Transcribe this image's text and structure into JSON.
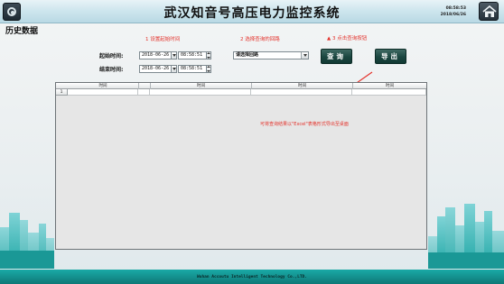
{
  "header": {
    "title": "武汉知音号高压电力监控系统",
    "time": "08:58:53",
    "date": "2018/06/26"
  },
  "page_title": "历史数据",
  "annotations": {
    "step1": "1 设置起始时间",
    "step2": "2 选择查询的回路",
    "step3": "3 点击查询按钮",
    "export_note": "可将查询结果以\"Excel\"表格形式导出至桌面"
  },
  "form": {
    "start_label": "起始时间:",
    "end_label": "结束时间:",
    "start_date": "2018-06-26",
    "start_time": "08:58:51",
    "end_date": "2018-06-26",
    "end_time": "08:58:51",
    "circuit_select_value": "请选择回路",
    "query_button": "查询",
    "export_button": "导出"
  },
  "table": {
    "columns": [
      "时间",
      "时间",
      "时间",
      "时间"
    ],
    "row_number": "1"
  },
  "footer": {
    "company": "Wuhan Accoutu Intelligent Technology Co.,LTD."
  },
  "colors": {
    "accent_red": "#e4322b",
    "button_dark_green": "#1b4640",
    "footer_teal": "#14918f"
  }
}
